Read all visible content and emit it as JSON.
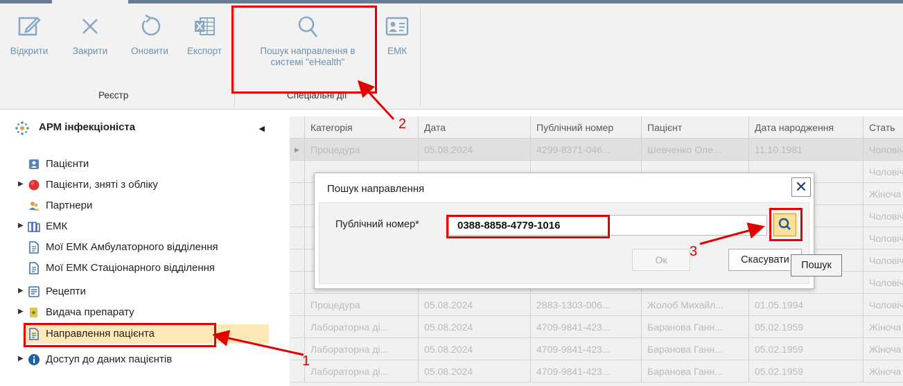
{
  "ribbon": {
    "buttons": [
      {
        "label": "Відкрити",
        "icon": "edit-icon"
      },
      {
        "label": "Закрити",
        "icon": "close-icon"
      },
      {
        "label": "Оновити",
        "icon": "refresh-icon"
      },
      {
        "label": "Експорт",
        "icon": "excel-export-icon"
      },
      {
        "label_line1": "Пошук направлення в",
        "label_line2": "системі \"eHealth\"",
        "icon": "search-icon"
      },
      {
        "label": "ЕМК",
        "icon": "id-card-icon"
      }
    ],
    "groups": {
      "registry": "Реєстр",
      "special": "Спеціальні дії"
    }
  },
  "sidebar": {
    "title": "АРМ інфекціоніста",
    "collapse_glyph": "◀",
    "items": [
      {
        "label": "Пацієнти",
        "has_arrow": false,
        "icon": "patients-icon"
      },
      {
        "label": "Пацієнти, зняті з обліку",
        "has_arrow": true,
        "icon": "red-circle-icon"
      },
      {
        "label": "Партнери",
        "has_arrow": false,
        "icon": "partners-icon"
      },
      {
        "label": "ЕМК",
        "has_arrow": true,
        "icon": "emk-icon"
      },
      {
        "label": "Мої ЕМК Амбулаторного відділення",
        "has_arrow": false,
        "icon": "document-icon"
      },
      {
        "label": "Мої ЕМК Стаціонарного відділення",
        "has_arrow": false,
        "icon": "document-icon"
      },
      {
        "label": "Рецепти",
        "has_arrow": true,
        "icon": "prescription-icon"
      },
      {
        "label": "Видача препарату",
        "has_arrow": true,
        "icon": "medicine-icon"
      },
      {
        "label": "Направлення пацієнта",
        "has_arrow": false,
        "icon": "document-icon",
        "selected": true
      },
      {
        "label": "Доступ до даних пацієнтів",
        "has_arrow": true,
        "icon": "info-icon"
      }
    ]
  },
  "grid": {
    "columns": [
      "Категорія",
      "Дата",
      "Публічний номер",
      "Пацієнт",
      "Дата народження",
      "Стать"
    ],
    "rows": [
      [
        "Процедура",
        "05.08.2024",
        "4299-8371-046...",
        "Шевченко Оле...",
        "11.10.1981",
        "Чоловіча"
      ],
      [
        "",
        "",
        "",
        "",
        "",
        "Чоловіча"
      ],
      [
        "",
        "",
        "",
        "",
        "",
        "Жіноча"
      ],
      [
        "",
        "",
        "",
        "",
        "",
        "Чоловіча"
      ],
      [
        "",
        "",
        "",
        "",
        "",
        "Чоловіча"
      ],
      [
        "",
        "",
        "",
        "",
        "",
        "Чоловіча"
      ],
      [
        "",
        "",
        "",
        "",
        "",
        "Чоловіча"
      ],
      [
        "Процедура",
        "05.08.2024",
        "2883-1303-006...",
        "Жолоб Михайл...",
        "01.05.1994",
        "Чоловіча"
      ],
      [
        "Лабораторна ді...",
        "05.08.2024",
        "4709-9841-423...",
        "Баранова Ганн...",
        "05.02.1959",
        "Жіноча"
      ],
      [
        "Лабораторна ді...",
        "05.08.2024",
        "4709-9841-423...",
        "Баранова Ганн...",
        "05.02.1959",
        "Жіноча"
      ],
      [
        "Лабораторна ді...",
        "05.08.2024",
        "4709-9841-423...",
        "Баранова Ганн...",
        "05.02.1959",
        "Жіноча"
      ]
    ]
  },
  "dialog": {
    "title": "Пошук направлення",
    "close_glyph": "✕",
    "field_label": "Публічний номер*",
    "field_value": "0388-8858-4779-1016",
    "ok_label": "Ок",
    "cancel_label": "Скасувати",
    "tooltip": "Пошук"
  },
  "annotations": {
    "steps": [
      "1",
      "2",
      "3"
    ],
    "color": "#e30000"
  }
}
